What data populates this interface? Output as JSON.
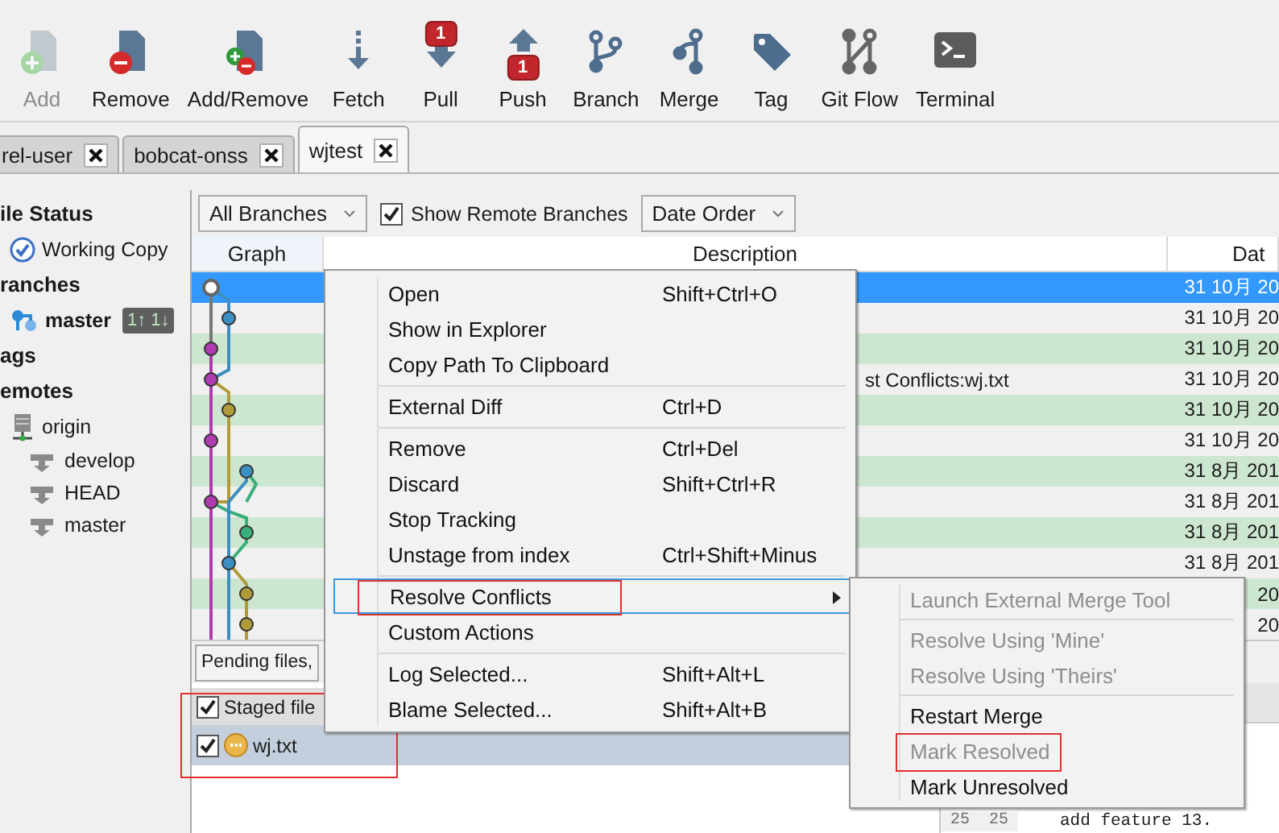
{
  "toolbar": [
    {
      "kind": "add",
      "label": "Add",
      "disabled": true
    },
    {
      "kind": "remove",
      "label": "Remove",
      "disabled": false
    },
    {
      "kind": "addremove",
      "label": "Add/Remove",
      "disabled": false
    },
    {
      "kind": "fetch",
      "label": "Fetch",
      "disabled": false
    },
    {
      "kind": "pull",
      "label": "Pull",
      "disabled": false,
      "badge": "1"
    },
    {
      "kind": "push",
      "label": "Push",
      "disabled": false,
      "badge": "1"
    },
    {
      "kind": "branch",
      "label": "Branch",
      "disabled": false
    },
    {
      "kind": "merge",
      "label": "Merge",
      "disabled": false
    },
    {
      "kind": "tag",
      "label": "Tag",
      "disabled": false
    },
    {
      "kind": "gitflow",
      "label": "Git Flow",
      "disabled": false
    },
    {
      "kind": "terminal",
      "label": "Terminal",
      "disabled": false
    }
  ],
  "tabs": [
    {
      "label": "rel-user",
      "selected": false
    },
    {
      "label": "bobcat-onss",
      "selected": false
    },
    {
      "label": "wjtest",
      "selected": true
    }
  ],
  "sidebar": {
    "sections": [
      {
        "title": "ile Status",
        "items": [
          {
            "kind": "working-copy",
            "label": "Working Copy"
          }
        ]
      },
      {
        "title": "ranches",
        "items": [
          {
            "kind": "branch",
            "label": "master",
            "current": true,
            "badge": "1↑ 1↓"
          }
        ]
      },
      {
        "title": "ags"
      },
      {
        "title": "emotes",
        "items": [
          {
            "kind": "remote",
            "label": "origin",
            "children": [
              {
                "kind": "remote-branch",
                "label": "develop"
              },
              {
                "kind": "remote-branch",
                "label": "HEAD"
              },
              {
                "kind": "remote-branch",
                "label": "master"
              }
            ]
          }
        ]
      }
    ]
  },
  "filters": {
    "branches": "All Branches",
    "show_remote": {
      "label": "Show Remote Branches",
      "checked": true
    },
    "order": "Date Order"
  },
  "commits": {
    "columns": [
      "Graph",
      "Description",
      "Dat"
    ],
    "rows": [
      {
        "date": "31 10月 20",
        "selected": true
      },
      {
        "date": "31 10月 20",
        "selected": false
      },
      {
        "date": "31 10月 20",
        "selected": false
      },
      {
        "description": "st Conflicts:wj.txt",
        "date": "31 10月 20",
        "selected": false
      },
      {
        "date": "31 10月 20",
        "selected": false
      },
      {
        "date": "31 10月 20",
        "selected": false
      },
      {
        "date": "31 8月 201",
        "selected": false
      },
      {
        "date": "31 8月 201",
        "selected": false
      },
      {
        "date": "31 8月 201",
        "selected": false
      },
      {
        "date": "31 8月 201",
        "selected": false
      },
      {
        "date": "20",
        "selected": false
      },
      {
        "date": "20",
        "selected": false
      }
    ]
  },
  "pending": {
    "dropdown": "Pending files,",
    "groups": [
      {
        "label": "Staged file",
        "checked": true,
        "highlighted": true,
        "files": [
          {
            "name": "wj.txt",
            "conflicted": true,
            "checked": true,
            "selected": true
          }
        ]
      }
    ]
  },
  "diff": {
    "lines": [
      {
        "old": "25",
        "new": "25",
        "text": "add feature 13."
      }
    ]
  },
  "context_menu": {
    "items": [
      {
        "kind": "item",
        "label": "Open",
        "shortcut": "Shift+Ctrl+O"
      },
      {
        "kind": "item",
        "label": "Show in Explorer"
      },
      {
        "kind": "item",
        "label": "Copy Path To Clipboard"
      },
      {
        "kind": "separator"
      },
      {
        "kind": "item",
        "label": "External Diff",
        "shortcut": "Ctrl+D"
      },
      {
        "kind": "separator"
      },
      {
        "kind": "item",
        "label": "Remove",
        "shortcut": "Ctrl+Del"
      },
      {
        "kind": "item",
        "label": "Discard",
        "shortcut": "Shift+Ctrl+R"
      },
      {
        "kind": "item",
        "label": "Stop Tracking"
      },
      {
        "kind": "item",
        "label": "Unstage from index",
        "shortcut": "Ctrl+Shift+Minus"
      },
      {
        "kind": "separator"
      },
      {
        "kind": "submenu",
        "label": "Resolve Conflicts",
        "hovered": true,
        "highlighted": true
      },
      {
        "kind": "item",
        "label": "Custom Actions"
      },
      {
        "kind": "separator"
      },
      {
        "kind": "item",
        "label": "Log Selected...",
        "shortcut": "Shift+Alt+L"
      },
      {
        "kind": "item",
        "label": "Blame Selected...",
        "shortcut": "Shift+Alt+B"
      }
    ]
  },
  "submenu": {
    "items": [
      {
        "kind": "item",
        "label": "Launch External Merge Tool",
        "disabled": true
      },
      {
        "kind": "separator"
      },
      {
        "kind": "item",
        "label": "Resolve Using 'Mine'",
        "disabled": true
      },
      {
        "kind": "item",
        "label": "Resolve Using 'Theirs'",
        "disabled": true
      },
      {
        "kind": "separator"
      },
      {
        "kind": "item",
        "label": "Restart Merge",
        "disabled": false
      },
      {
        "kind": "item",
        "label": "Mark Resolved",
        "disabled": true,
        "highlighted": true
      },
      {
        "kind": "item",
        "label": "Mark Unresolved",
        "disabled": false
      }
    ]
  }
}
